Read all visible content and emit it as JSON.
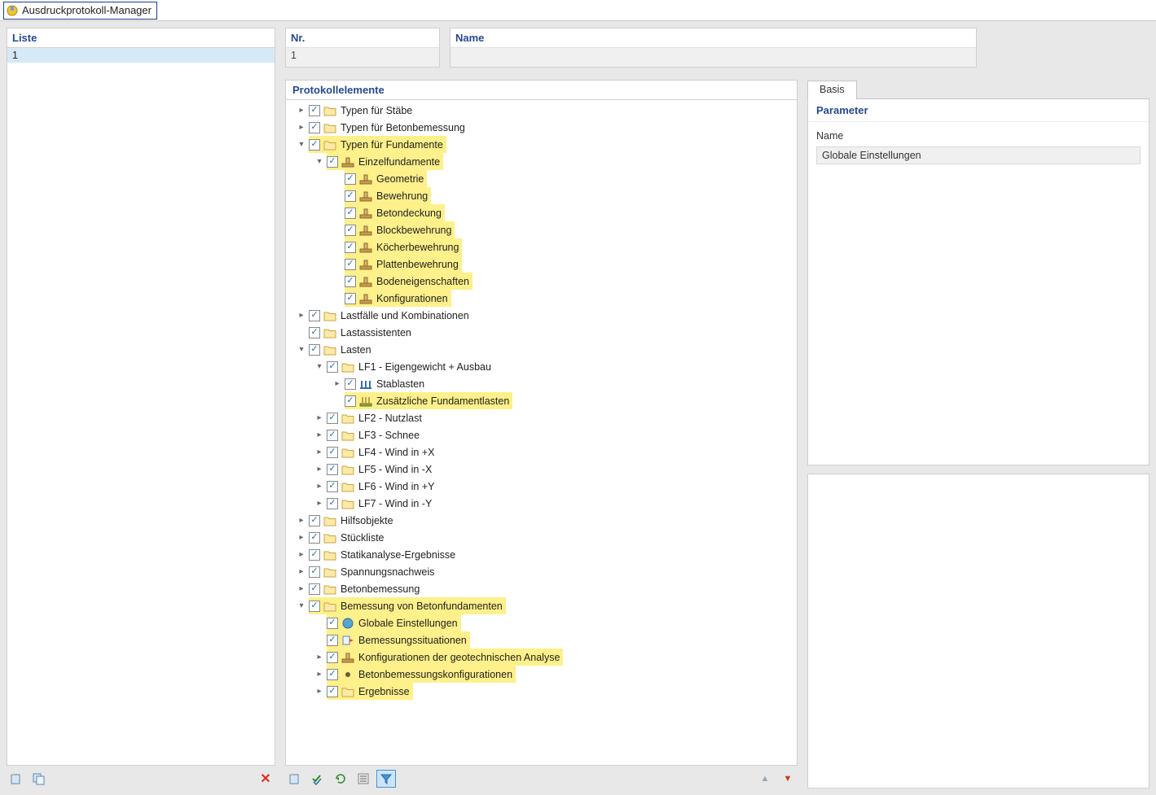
{
  "window": {
    "title": "Ausdruckprotokoll-Manager"
  },
  "left": {
    "header": "Liste",
    "items": [
      "1"
    ]
  },
  "fields": {
    "nr_label": "Nr.",
    "nr_value": "1",
    "name_label": "Name",
    "name_value": ""
  },
  "tree": {
    "header": "Protokollelemente",
    "nodes": [
      {
        "d": 0,
        "exp": "closed",
        "chk": true,
        "icon": "folder",
        "label": "Typen für Stäbe",
        "hl": false
      },
      {
        "d": 0,
        "exp": "closed",
        "chk": true,
        "icon": "folder",
        "label": "Typen für Betonbemessung",
        "hl": false
      },
      {
        "d": 0,
        "exp": "open",
        "chk": true,
        "icon": "folder",
        "label": "Typen für Fundamente",
        "hl": true
      },
      {
        "d": 1,
        "exp": "open",
        "chk": true,
        "icon": "fund",
        "label": "Einzelfundamente",
        "hl": true
      },
      {
        "d": 2,
        "exp": "none",
        "chk": true,
        "icon": "fund",
        "label": "Geometrie",
        "hl": true
      },
      {
        "d": 2,
        "exp": "none",
        "chk": true,
        "icon": "fund",
        "label": "Bewehrung",
        "hl": true
      },
      {
        "d": 2,
        "exp": "none",
        "chk": true,
        "icon": "fund",
        "label": "Betondeckung",
        "hl": true
      },
      {
        "d": 2,
        "exp": "none",
        "chk": true,
        "icon": "fund",
        "label": "Blockbewehrung",
        "hl": true
      },
      {
        "d": 2,
        "exp": "none",
        "chk": true,
        "icon": "fund",
        "label": "Köcherbewehrung",
        "hl": true
      },
      {
        "d": 2,
        "exp": "none",
        "chk": true,
        "icon": "fund",
        "label": "Plattenbewehrung",
        "hl": true
      },
      {
        "d": 2,
        "exp": "none",
        "chk": true,
        "icon": "fund",
        "label": "Bodeneigenschaften",
        "hl": true
      },
      {
        "d": 2,
        "exp": "none",
        "chk": true,
        "icon": "fund",
        "label": "Konfigurationen",
        "hl": true
      },
      {
        "d": 0,
        "exp": "closed",
        "chk": true,
        "icon": "folder",
        "label": "Lastfälle und Kombinationen",
        "hl": false
      },
      {
        "d": 0,
        "exp": "none",
        "chk": true,
        "icon": "folder",
        "label": "Lastassistenten",
        "hl": false
      },
      {
        "d": 0,
        "exp": "open",
        "chk": true,
        "icon": "folder",
        "label": "Lasten",
        "hl": false
      },
      {
        "d": 1,
        "exp": "open",
        "chk": true,
        "icon": "folder",
        "label": "LF1 - Eigengewicht + Ausbau",
        "hl": false
      },
      {
        "d": 2,
        "exp": "closed",
        "chk": true,
        "icon": "load",
        "label": "Stablasten",
        "hl": false
      },
      {
        "d": 2,
        "exp": "none",
        "chk": true,
        "icon": "fload",
        "label": "Zusätzliche Fundamentlasten",
        "hl": true
      },
      {
        "d": 1,
        "exp": "closed",
        "chk": true,
        "icon": "folder",
        "label": "LF2 - Nutzlast",
        "hl": false
      },
      {
        "d": 1,
        "exp": "closed",
        "chk": true,
        "icon": "folder",
        "label": "LF3 - Schnee",
        "hl": false
      },
      {
        "d": 1,
        "exp": "closed",
        "chk": true,
        "icon": "folder",
        "label": "LF4 - Wind in +X",
        "hl": false
      },
      {
        "d": 1,
        "exp": "closed",
        "chk": true,
        "icon": "folder",
        "label": "LF5 - Wind in -X",
        "hl": false
      },
      {
        "d": 1,
        "exp": "closed",
        "chk": true,
        "icon": "folder",
        "label": "LF6 - Wind in +Y",
        "hl": false
      },
      {
        "d": 1,
        "exp": "closed",
        "chk": true,
        "icon": "folder",
        "label": "LF7 - Wind in -Y",
        "hl": false
      },
      {
        "d": 0,
        "exp": "closed",
        "chk": true,
        "icon": "folder",
        "label": "Hilfsobjekte",
        "hl": false
      },
      {
        "d": 0,
        "exp": "closed",
        "chk": true,
        "icon": "folder",
        "label": "Stückliste",
        "hl": false
      },
      {
        "d": 0,
        "exp": "closed",
        "chk": true,
        "icon": "folder",
        "label": "Statikanalyse-Ergebnisse",
        "hl": false
      },
      {
        "d": 0,
        "exp": "closed",
        "chk": true,
        "icon": "folder",
        "label": "Spannungsnachweis",
        "hl": false
      },
      {
        "d": 0,
        "exp": "closed",
        "chk": true,
        "icon": "folder",
        "label": "Betonbemessung",
        "hl": false
      },
      {
        "d": 0,
        "exp": "open",
        "chk": true,
        "icon": "folder",
        "label": "Bemessung von Betonfundamenten",
        "hl": true
      },
      {
        "d": 1,
        "exp": "none",
        "chk": true,
        "icon": "globe",
        "label": "Globale Einstellungen",
        "hl": true
      },
      {
        "d": 1,
        "exp": "none",
        "chk": true,
        "icon": "situ",
        "label": "Bemessungssituationen",
        "hl": true
      },
      {
        "d": 1,
        "exp": "closed",
        "chk": true,
        "icon": "fund",
        "label": "Konfigurationen der geotechnischen Analyse",
        "hl": true
      },
      {
        "d": 1,
        "exp": "closed",
        "chk": true,
        "icon": "dot",
        "label": "Betonbemessungskonfigurationen",
        "hl": true
      },
      {
        "d": 1,
        "exp": "closed",
        "chk": true,
        "icon": "folder",
        "label": "Ergebnisse",
        "hl": true
      }
    ]
  },
  "right": {
    "tab": "Basis",
    "param_header": "Parameter",
    "param_name_label": "Name",
    "param_name_value": "Globale Einstellungen"
  },
  "toolbar": {
    "new": "new",
    "copy": "copy",
    "delete": "delete",
    "newtree": "newtree",
    "checkall": "checkall",
    "refresh": "refresh",
    "list": "list",
    "filter": "filter",
    "up": "up",
    "down": "down"
  }
}
